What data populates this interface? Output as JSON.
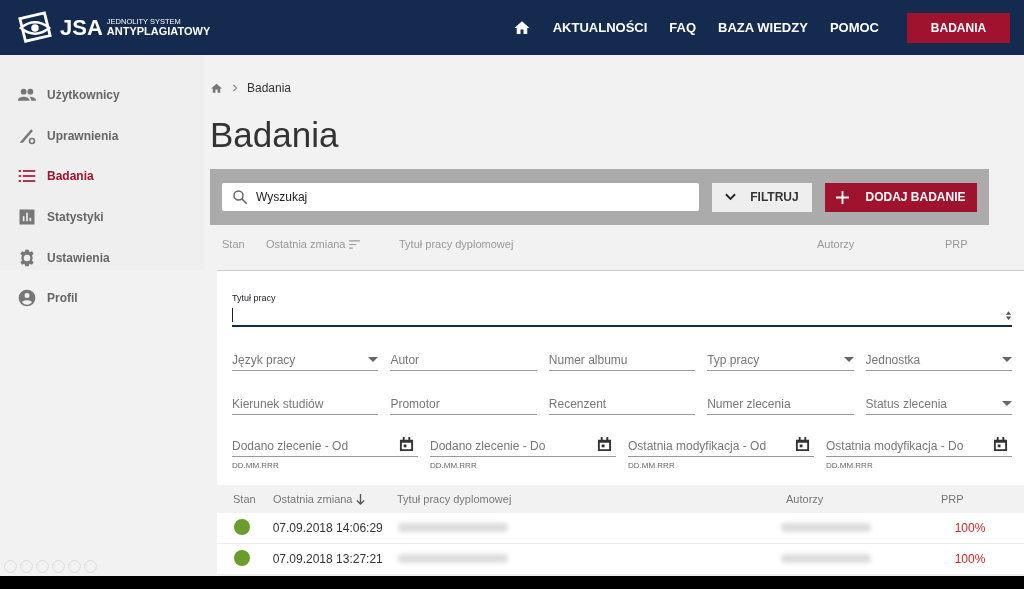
{
  "header": {
    "logo": {
      "short": "JSA",
      "line1": "JEDNOLITY SYSTEM",
      "line2": "ANTYPLAGIATOWY"
    },
    "nav": [
      {
        "label": "AKTUALNOŚCI"
      },
      {
        "label": "FAQ"
      },
      {
        "label": "BAZA WIEDZY"
      },
      {
        "label": "POMOC"
      }
    ],
    "cta": "BADANIA"
  },
  "sidebar": {
    "items": [
      {
        "label": "Użytkownicy",
        "selected": false
      },
      {
        "label": "Uprawnienia",
        "selected": false
      },
      {
        "label": "Badania",
        "selected": true
      },
      {
        "label": "Statystyki",
        "selected": false
      },
      {
        "label": "Ustawienia",
        "selected": false
      }
    ],
    "profile": "Profil"
  },
  "breadcrumb": [
    "Badania"
  ],
  "title": "Badania",
  "search": {
    "placeholder": "Wyszukaj"
  },
  "filter_button": "FILTRUJ",
  "add_button": "DODAJ BADANIE",
  "columns_top": [
    {
      "label": "Stan",
      "kind": "plain"
    },
    {
      "label": "Ostatnia zmiana",
      "kind": "sortable"
    },
    {
      "label": "Tytuł pracy dyplomowej",
      "kind": "plain"
    },
    {
      "label": "Autorzy",
      "kind": "plain"
    },
    {
      "label": "PRP",
      "kind": "plain"
    }
  ],
  "filters": {
    "title_field": {
      "label": "Tytuł pracy",
      "focused": true
    },
    "fields": [
      {
        "kind": "select",
        "label": "Język pracy"
      },
      {
        "kind": "text",
        "placeholder": "Autor"
      },
      {
        "kind": "text",
        "placeholder": "Numer albumu"
      },
      {
        "kind": "select",
        "label": "Typ pracy"
      },
      {
        "kind": "select",
        "label": "Jednostka"
      },
      {
        "kind": "text",
        "placeholder": "Kierunek studiów"
      },
      {
        "kind": "text",
        "placeholder": "Promotor"
      },
      {
        "kind": "text",
        "placeholder": "Recenzent"
      },
      {
        "kind": "text",
        "placeholder": "Numer zlecenia"
      },
      {
        "kind": "select",
        "label": "Status zlecenia"
      }
    ],
    "date_fields": [
      {
        "placeholder": "Dodano zlecenie - Od",
        "hint": "DD.MM.RRR"
      },
      {
        "placeholder": "Dodano zlecenie - Do",
        "hint": "DD.MM.RRR"
      },
      {
        "placeholder": "Ostatnia modyfikacja - Od",
        "hint": "DD.MM.RRR"
      },
      {
        "placeholder": "Ostatnia modyfikacja - Do",
        "hint": "DD.MM.RRR"
      }
    ]
  },
  "columns": [
    {
      "label": "Stan",
      "kind": "plain"
    },
    {
      "label": "Ostatnia zmiana",
      "kind": "sorted_descending"
    },
    {
      "label": "Tytuł pracy dyplomowej",
      "kind": "plain"
    },
    {
      "label": "Autorzy",
      "kind": "plain"
    },
    {
      "label": "PRP",
      "kind": "plain"
    }
  ],
  "rows": [
    {
      "color": "#6a9d2b",
      "changed": "07.09.2018 14:06:29",
      "prp": "100%"
    },
    {
      "color": "#6a9d2b",
      "changed": "07.09.2018 13:27:21",
      "prp": "100%"
    }
  ]
}
